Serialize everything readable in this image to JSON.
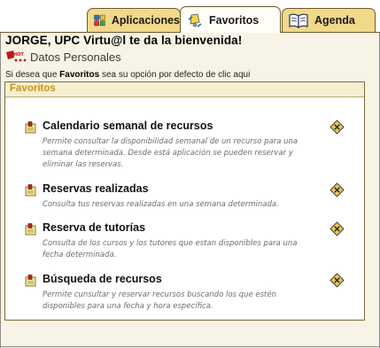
{
  "tabs": [
    {
      "label": "Aplicaciones",
      "icon": "puzzle-icon",
      "active": false
    },
    {
      "label": "Favoritos",
      "icon": "bell-icon",
      "active": true
    },
    {
      "label": "Agenda",
      "icon": "book-icon",
      "active": false
    }
  ],
  "greeting": "JORGE, UPC Virtu@l te da la bienvenida!",
  "datos_personales": {
    "label": "Datos Personales",
    "icon": "hot-badge-icon"
  },
  "hint": {
    "prefix": "Si desea que ",
    "bold": "Favoritos",
    "suffix": " sea su opción por defecto de clic ",
    "link": "aqui"
  },
  "panel": {
    "title": "Favoritos",
    "items": [
      {
        "title": "Calendario semanal de recursos",
        "desc": "Permite consultar la disponibilidad semanal de un recurso para una semana determinada. Desde está aplicación se pueden reservar y eliminar las reservas."
      },
      {
        "title": "Reservas realizadas",
        "desc": "Consulta tus reservas realizadas en una semana determinada."
      },
      {
        "title": "Reserva de tutorías",
        "desc": "Consulta de los cursos y los tutores que estan disponibles para una fecha determinada."
      },
      {
        "title": "Búsqueda de recursos",
        "desc": "Permite cunsultar y reservar recursos buscando los que estén disponibles para una fecha y hora específica."
      }
    ]
  },
  "colors": {
    "tab": "#f1d98a",
    "panel_header_text": "#c8921a",
    "remove_icon": "#e9c84a"
  }
}
